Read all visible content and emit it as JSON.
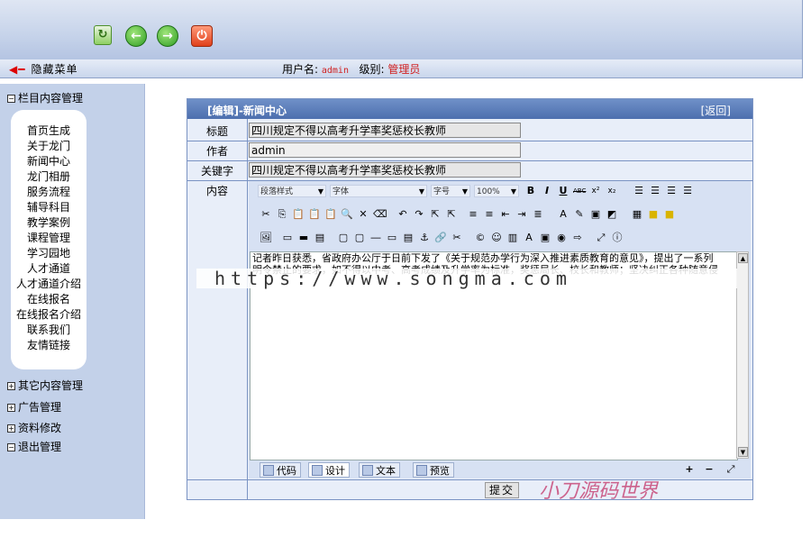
{
  "topbar": {
    "hide_menu": "隐藏菜单",
    "user_label": "用户名:",
    "user_value": "admin",
    "level_label": "级别:",
    "level_value": "管理员",
    "icons": [
      "refresh-icon",
      "back-arrow-icon",
      "forward-arrow-icon",
      "power-icon"
    ]
  },
  "sidebar": {
    "group_content": "栏目内容管理",
    "items": [
      "首页生成",
      "关于龙门",
      "新闻中心",
      "龙门相册",
      "服务流程",
      "辅导科目",
      "教学案例",
      "课程管理",
      "学习园地",
      "人才通道",
      "人才通道介绍",
      "在线报名",
      "在线报名介绍",
      "联系我们",
      "友情链接"
    ],
    "group_other": "其它内容管理",
    "group_ads": "广告管理",
    "group_profile": "资料修改",
    "group_logout": "退出管理"
  },
  "panel": {
    "title": "[编辑]-新闻中心",
    "back": "[返回]",
    "label_title": "标题",
    "label_author": "作者",
    "label_keywords": "关键字",
    "label_content": "内容",
    "title_value": "四川规定不得以高考升学率奖惩校长教师",
    "author_value": "admin",
    "keywords_value": "四川规定不得以高考升学率奖惩校长教师",
    "submit": "提交"
  },
  "editor": {
    "para_style": "段落样式",
    "font": "字体",
    "size": "字号",
    "zoom": "100%",
    "content_line1": "记者昨日获悉，省政府办公厅于日前下发了《关于规范办学行为深入推进素质教育的意见》，提出了一系列",
    "content_line2": "明令禁止的要求，如不得以中考、高考成绩及升学率为标准，奖惩局长、校长和教师；坚决纠正各种随意侵",
    "modes": [
      "代码",
      "设计",
      "文本",
      "预览"
    ]
  },
  "watermarks": {
    "url": "https://www.songma.com",
    "brand": "小刀源码世界"
  }
}
